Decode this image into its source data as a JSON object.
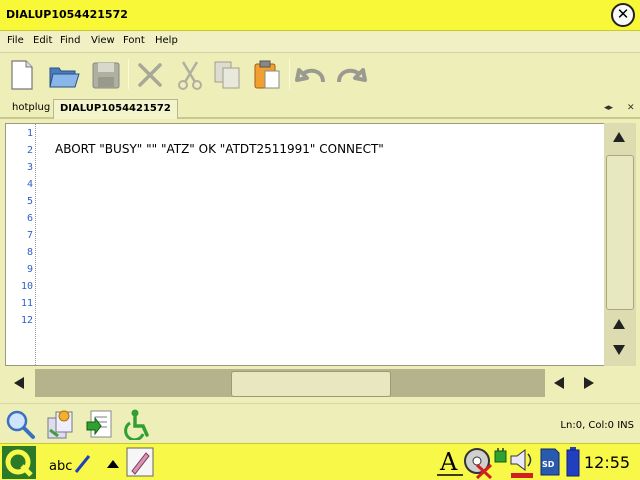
{
  "window": {
    "title": "DIALUP1054421572"
  },
  "menu": {
    "items": [
      "File",
      "Edit",
      "Find",
      "View",
      "Font",
      "Help"
    ]
  },
  "toolbar": {
    "icons": [
      "new-document-icon",
      "open-folder-icon",
      "save-icon",
      "cut-x-icon",
      "scissors-icon",
      "copy-icon",
      "paste-icon",
      "undo-icon",
      "redo-icon"
    ]
  },
  "tabs": [
    {
      "label": "hotplug"
    },
    {
      "label": "DIALUP1054421572"
    }
  ],
  "editor": {
    "line_numbers": [
      "1",
      "2",
      "3",
      "4",
      "5",
      "6",
      "7",
      "8",
      "9",
      "10",
      "11",
      "12"
    ],
    "code_line": "ABORT \"BUSY\" \"\" \"ATZ\" OK \"ATDT2511991\" CONNECT\""
  },
  "statusbar": {
    "position": "Ln:0, Col:0 INS"
  },
  "taskbar": {
    "clock": "12:55"
  },
  "colors": {
    "titlebar": "#f8f838",
    "background": "#eeeeb8",
    "line_numbers": "#3060c8"
  }
}
